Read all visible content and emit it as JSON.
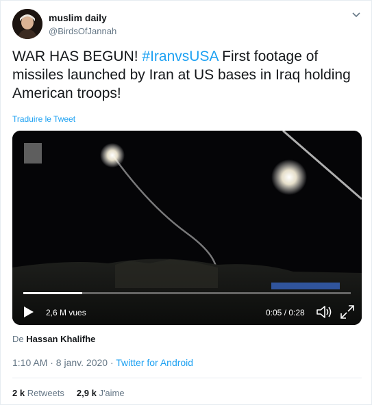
{
  "author": {
    "display_name": "muslim daily",
    "handle": "@BirdsOfJannah",
    "avatar_icon": "profile-avatar"
  },
  "tweet": {
    "text_prefix": "WAR HAS BEGUN! ",
    "hashtag": "#IranvsUSA",
    "text_suffix": " First footage of missiles launched by Iran at US bases in Iraq holding American troops!",
    "translate_label": "Traduire le Tweet"
  },
  "video": {
    "views": "2,6 M vues",
    "time": "0:05 / 0:28",
    "progress": 0.179,
    "play_icon": "play-icon",
    "volume_icon": "volume-icon",
    "fullscreen_icon": "fullscreen-icon"
  },
  "source": {
    "prefix": "De ",
    "name": "Hassan Khalifhe"
  },
  "meta": {
    "time_date": "1:10 AM · 8 janv. 2020 · ",
    "client": "Twitter for Android"
  },
  "stats": {
    "retweets_count": "2 k",
    "retweets_label": "Retweets",
    "likes_count": "2,9 k",
    "likes_label": "J'aime"
  },
  "colors": {
    "accent": "#1da1f2",
    "secondary_text": "#657786",
    "border": "#e6ecf0"
  }
}
